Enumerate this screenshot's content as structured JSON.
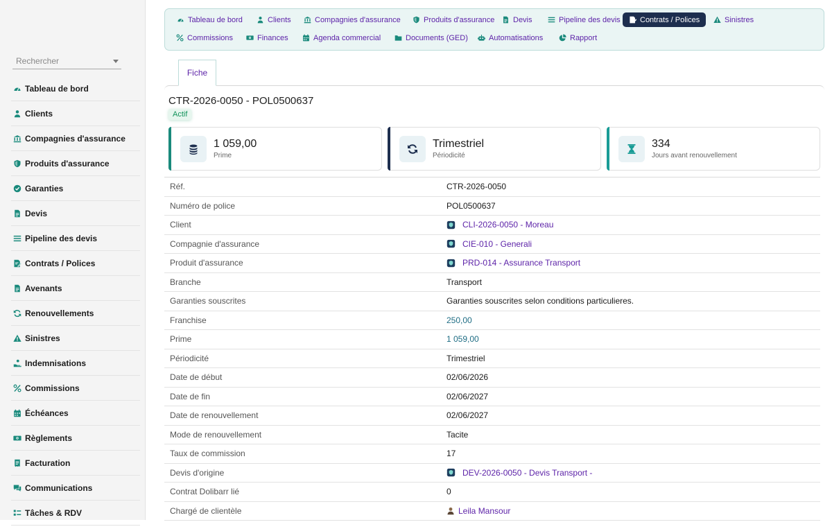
{
  "sidebar": {
    "search_placeholder": "Rechercher",
    "items": [
      {
        "label": "Tableau de bord",
        "icon": "dashboard-icon"
      },
      {
        "label": "Clients",
        "icon": "user-icon"
      },
      {
        "label": "Compagnies d'assurance",
        "icon": "bank-icon"
      },
      {
        "label": "Produits d'assurance",
        "icon": "shield-icon"
      },
      {
        "label": "Garanties",
        "icon": "check-circle-icon"
      },
      {
        "label": "Devis",
        "icon": "document-icon"
      },
      {
        "label": "Pipeline des devis",
        "icon": "list-icon"
      },
      {
        "label": "Contrats / Polices",
        "icon": "contract-icon"
      },
      {
        "label": "Avenants",
        "icon": "document-icon"
      },
      {
        "label": "Renouvellements",
        "icon": "sync-icon"
      },
      {
        "label": "Sinistres",
        "icon": "warning-icon"
      },
      {
        "label": "Indemnisations",
        "icon": "hand-coin-icon"
      },
      {
        "label": "Commissions",
        "icon": "percent-icon"
      },
      {
        "label": "Échéances",
        "icon": "calendar-icon"
      },
      {
        "label": "Règlements",
        "icon": "money-icon"
      },
      {
        "label": "Facturation",
        "icon": "invoice-icon"
      },
      {
        "label": "Communications",
        "icon": "chat-icon"
      },
      {
        "label": "Tâches & RDV",
        "icon": "tasks-icon"
      }
    ]
  },
  "topnav": {
    "items": [
      {
        "label": "Tableau de bord",
        "icon": "dashboard-icon",
        "active": false
      },
      {
        "label": "Clients",
        "icon": "user-icon",
        "active": false
      },
      {
        "label": "Compagnies d'assurance",
        "icon": "bank-icon",
        "active": false
      },
      {
        "label": "Produits d'assurance",
        "icon": "shield-icon",
        "active": false
      },
      {
        "label": "Devis",
        "icon": "document-icon",
        "active": false
      },
      {
        "label": "Pipeline des devis",
        "icon": "list-icon",
        "active": false
      },
      {
        "label": "Contrats / Polices",
        "icon": "contract-icon",
        "active": true
      },
      {
        "label": "Sinistres",
        "icon": "warning-icon",
        "active": false
      },
      {
        "label": "Commissions",
        "icon": "percent-icon",
        "active": false
      },
      {
        "label": "Finances",
        "icon": "money-icon",
        "active": false
      },
      {
        "label": "Agenda commercial",
        "icon": "calendar-icon",
        "active": false
      },
      {
        "label": "Documents (GED)",
        "icon": "folder-icon",
        "active": false
      },
      {
        "label": "Automatisations",
        "icon": "robot-icon",
        "active": false
      },
      {
        "label": "Rapport",
        "icon": "pie-chart-icon",
        "active": false
      }
    ]
  },
  "tab": {
    "label": "Fiche"
  },
  "record": {
    "title": "CTR-2026-0050 - POL0500637",
    "status": "Actif"
  },
  "kpis": [
    {
      "value": "1 059,00",
      "label": "Prime",
      "icon": "coins-icon",
      "color": "#1a8a7c"
    },
    {
      "value": "Trimestriel",
      "label": "Périodicité",
      "icon": "sync-icon",
      "color": "#1d2e4e"
    },
    {
      "value": "334",
      "label": "Jours avant renouvellement",
      "icon": "hourglass-icon",
      "color": "#1a9c96"
    }
  ],
  "fields": [
    {
      "label": "Réf.",
      "value": "CTR-2026-0050",
      "type": "text"
    },
    {
      "label": "Numéro de police",
      "value": "POL0500637",
      "type": "text"
    },
    {
      "label": "Client",
      "value": "CLI-2026-0050 - Moreau",
      "type": "link"
    },
    {
      "label": "Compagnie d'assurance",
      "value": "CIE-010 - Generali",
      "type": "link"
    },
    {
      "label": "Produit d'assurance",
      "value": "PRD-014 - Assurance Transport",
      "type": "link"
    },
    {
      "label": "Branche",
      "value": "Transport",
      "type": "text"
    },
    {
      "label": "Garanties souscrites",
      "value": "Garanties souscrites selon conditions particulieres.",
      "type": "text"
    },
    {
      "label": "Franchise",
      "value": "250,00",
      "type": "money"
    },
    {
      "label": "Prime",
      "value": "1 059,00",
      "type": "money"
    },
    {
      "label": "Périodicité",
      "value": "Trimestriel",
      "type": "text"
    },
    {
      "label": "Date de début",
      "value": "02/06/2026",
      "type": "text"
    },
    {
      "label": "Date de fin",
      "value": "02/06/2027",
      "type": "text"
    },
    {
      "label": "Date de renouvellement",
      "value": "02/06/2027",
      "type": "text"
    },
    {
      "label": "Mode de renouvellement",
      "value": "Tacite",
      "type": "text"
    },
    {
      "label": "Taux de commission",
      "value": "17",
      "type": "text"
    },
    {
      "label": "Devis d'origine",
      "value": "DEV-2026-0050 - Devis Transport -",
      "type": "link"
    },
    {
      "label": "Contrat Dolibarr lié",
      "value": "0",
      "type": "text"
    },
    {
      "label": "Chargé de clientèle",
      "value": "Leila Mansour",
      "type": "user"
    }
  ],
  "colors": {
    "accent": "#5d23a8",
    "teal": "#1a8a7c",
    "navy": "#1d2e4e",
    "success": "#12935a"
  }
}
